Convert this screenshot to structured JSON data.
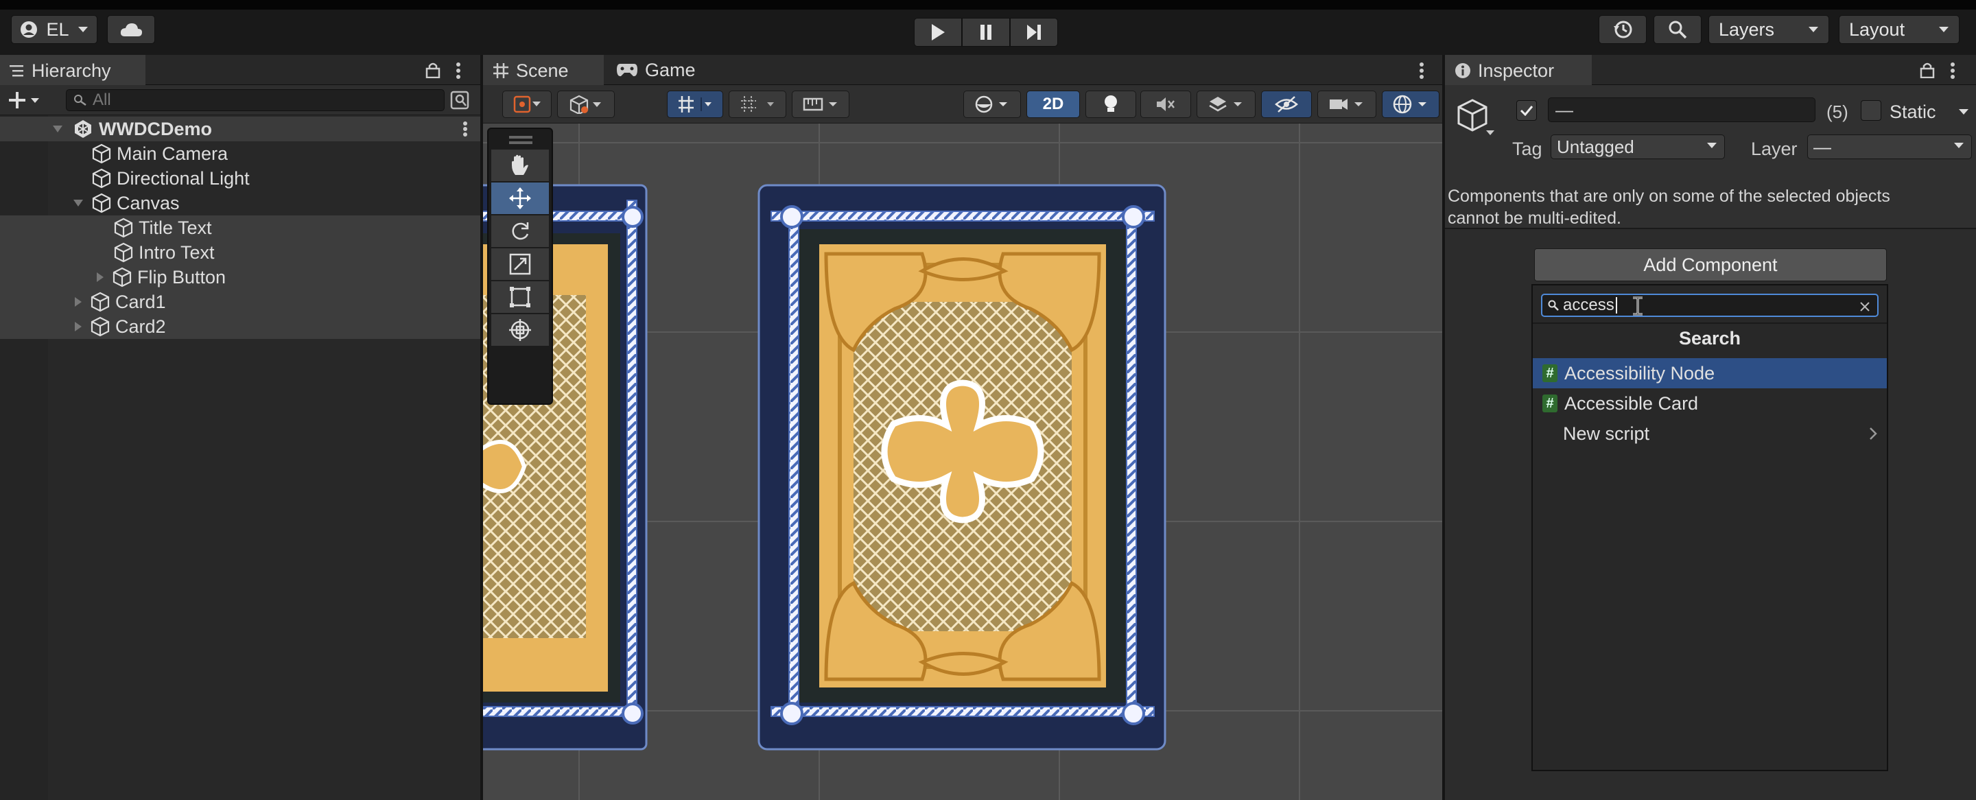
{
  "toolbar": {
    "account_label": "EL",
    "layers_label": "Layers",
    "layout_label": "Layout"
  },
  "hierarchy": {
    "tab_label": "Hierarchy",
    "search_placeholder": "All",
    "root": "WWDCDemo",
    "items": [
      {
        "label": "Main Camera"
      },
      {
        "label": "Directional Light"
      },
      {
        "label": "Canvas"
      },
      {
        "label": "Title Text"
      },
      {
        "label": "Intro Text"
      },
      {
        "label": "Flip Button"
      },
      {
        "label": "Card1"
      },
      {
        "label": "Card2"
      }
    ]
  },
  "scene": {
    "tabs": [
      {
        "label": "Scene"
      },
      {
        "label": "Game"
      }
    ],
    "mode_2d_label": "2D"
  },
  "inspector": {
    "tab_label": "Inspector",
    "name_value": "—",
    "count_label": "(5)",
    "static_label": "Static",
    "tag_label": "Tag",
    "tag_value": "Untagged",
    "layer_label": "Layer",
    "layer_value": "—",
    "message_line1": "Components that are only on some of the selected objects",
    "message_line2": "cannot be multi-edited.",
    "add_component_label": "Add Component",
    "popup": {
      "search_value": "access",
      "header": "Search",
      "items": [
        {
          "label": "Accessibility Node",
          "icon": "script-hash-icon"
        },
        {
          "label": "Accessible Card",
          "icon": "script-hash-icon"
        },
        {
          "label": "New script",
          "icon": "chevron-right-icon"
        }
      ]
    }
  },
  "colors": {
    "selection_blue": "#2d4f86",
    "accent_blue": "#4f8ad8",
    "card_gold": "#e8b55c",
    "card_navy": "#1e2a4f"
  }
}
